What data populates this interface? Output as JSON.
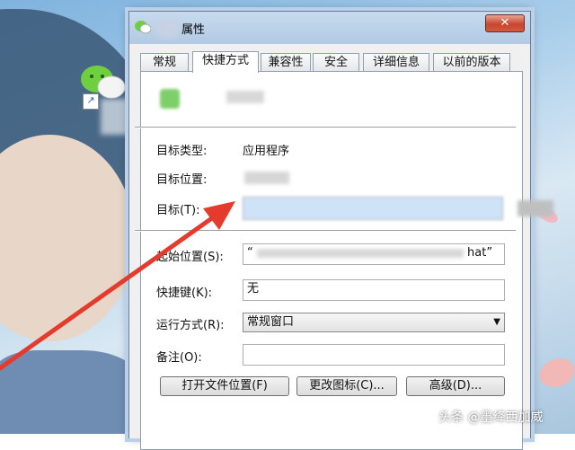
{
  "window": {
    "title": "属性",
    "close_label": "✕"
  },
  "tabs": [
    {
      "label": "常规",
      "active": false
    },
    {
      "label": "快捷方式",
      "active": true
    },
    {
      "label": "兼容性",
      "active": false
    },
    {
      "label": "安全",
      "active": false
    },
    {
      "label": "详细信息",
      "active": false
    },
    {
      "label": "以前的版本",
      "active": false
    }
  ],
  "shortcut": {
    "target_type_label": "目标类型:",
    "target_type_value": "应用程序",
    "target_location_label": "目标位置:",
    "target_label": "目标(T):",
    "start_in_label": "起始位置(S):",
    "start_in_value_prefix": "“",
    "start_in_value_suffix": "hat”",
    "hotkey_label": "快捷键(K):",
    "hotkey_value": "无",
    "run_label": "运行方式(R):",
    "run_value": "常规窗口",
    "comment_label": "备注(O):",
    "comment_value": ""
  },
  "buttons": {
    "open_location": "打开文件位置(F)",
    "change_icon": "更改图标(C)...",
    "advanced": "高级(D)..."
  },
  "watermark": "头条 @墨绛西加威",
  "colors": {
    "arrow": "#e43b2c",
    "title_bar": "#b9d1ea",
    "selected_field": "#cfe3f8"
  }
}
